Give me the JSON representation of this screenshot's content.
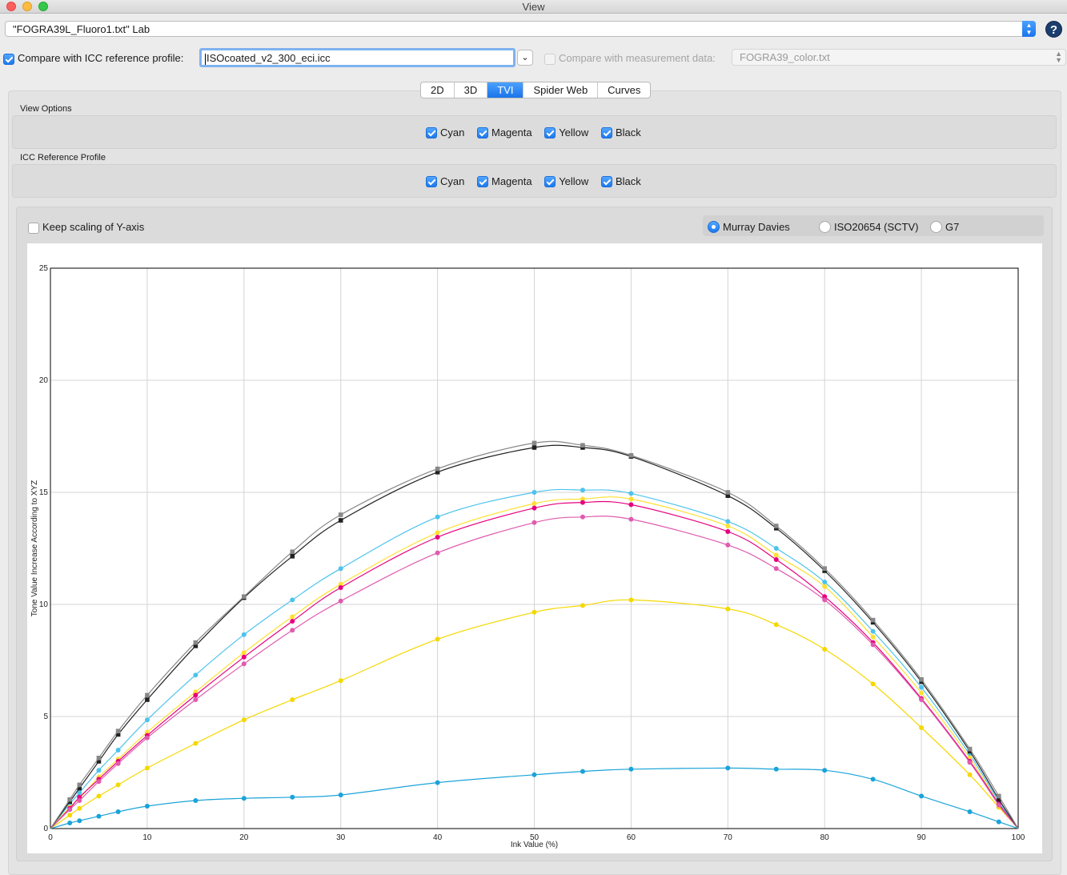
{
  "window": {
    "title": "View"
  },
  "file_select": {
    "value": "\"FOGRA39L_Fluoro1.txt\" Lab"
  },
  "help": {
    "label": "?"
  },
  "compare_icc": {
    "label": "Compare with ICC reference profile:",
    "checked": true,
    "value": "ISOcoated_v2_300_eci.icc"
  },
  "compare_measurement": {
    "label": "Compare with measurement data:",
    "checked": false,
    "value": "FOGRA39_color.txt"
  },
  "tabs": [
    {
      "label": "2D",
      "active": false
    },
    {
      "label": "3D",
      "active": false
    },
    {
      "label": "TVI",
      "active": true
    },
    {
      "label": "Spider Web",
      "active": false
    },
    {
      "label": "Curves",
      "active": false
    }
  ],
  "view_options": {
    "title": "View Options",
    "items": [
      {
        "label": "Cyan",
        "checked": true
      },
      {
        "label": "Magenta",
        "checked": true
      },
      {
        "label": "Yellow",
        "checked": true
      },
      {
        "label": "Black",
        "checked": true
      }
    ]
  },
  "icc_reference": {
    "title": "ICC Reference Profile",
    "items": [
      {
        "label": "Cyan",
        "checked": true
      },
      {
        "label": "Magenta",
        "checked": true
      },
      {
        "label": "Yellow",
        "checked": true
      },
      {
        "label": "Black",
        "checked": true
      }
    ]
  },
  "keep_scaling": {
    "label": "Keep scaling of Y-axis",
    "checked": false
  },
  "tvi_method": {
    "options": [
      {
        "label": "Murray Davies",
        "selected": true
      },
      {
        "label": "ISO20654 (SCTV)",
        "selected": false
      },
      {
        "label": "G7",
        "selected": false
      }
    ]
  },
  "chart_data": {
    "type": "line",
    "xlabel": "Ink Value (%)",
    "ylabel": "Tone Value Increase According to XYZ",
    "xlim": [
      0,
      100
    ],
    "ylim": [
      0,
      25
    ],
    "xticks": [
      0,
      10,
      20,
      30,
      40,
      50,
      60,
      70,
      80,
      90,
      100
    ],
    "yticks": [
      0,
      5,
      10,
      15,
      20,
      25
    ],
    "grid": true,
    "x": [
      0,
      2,
      3,
      5,
      7,
      10,
      15,
      20,
      25,
      30,
      40,
      50,
      55,
      60,
      70,
      75,
      80,
      85,
      90,
      95,
      98,
      100
    ],
    "series": [
      {
        "color": "#1aa3d9",
        "values": [
          0,
          0.25,
          0.35,
          0.55,
          0.75,
          1.0,
          1.25,
          1.35,
          1.4,
          1.5,
          2.05,
          2.4,
          2.55,
          2.65,
          2.7,
          2.65,
          2.6,
          2.2,
          1.45,
          0.75,
          0.3,
          0
        ]
      },
      {
        "color": "#4dc3ec",
        "values": [
          0,
          1.1,
          1.6,
          2.6,
          3.5,
          4.85,
          6.85,
          8.65,
          10.2,
          11.6,
          13.9,
          15.0,
          15.1,
          14.95,
          13.7,
          12.5,
          11.0,
          8.8,
          6.3,
          3.3,
          1.2,
          0
        ]
      },
      {
        "color": "#f5d800",
        "values": [
          0,
          0.6,
          0.9,
          1.45,
          1.95,
          2.7,
          3.8,
          4.85,
          5.75,
          6.6,
          8.45,
          9.65,
          9.95,
          10.2,
          9.8,
          9.1,
          8.0,
          6.45,
          4.5,
          2.4,
          0.95,
          0
        ]
      },
      {
        "color": "#ffe033",
        "values": [
          0,
          0.95,
          1.35,
          2.3,
          3.1,
          4.3,
          6.1,
          7.85,
          9.45,
          10.9,
          13.2,
          14.5,
          14.7,
          14.7,
          13.5,
          12.2,
          10.8,
          8.55,
          6.05,
          3.15,
          1.1,
          0
        ]
      },
      {
        "color": "#e6007e",
        "values": [
          0,
          0.9,
          1.4,
          2.2,
          3.0,
          4.15,
          5.95,
          7.65,
          9.25,
          10.75,
          13.0,
          14.3,
          14.55,
          14.45,
          13.25,
          12.0,
          10.35,
          8.3,
          5.8,
          3.0,
          1.1,
          0
        ]
      },
      {
        "color": "#e05bb0",
        "values": [
          0,
          0.85,
          1.25,
          2.1,
          2.9,
          4.05,
          5.75,
          7.35,
          8.85,
          10.15,
          12.3,
          13.65,
          13.9,
          13.8,
          12.65,
          11.6,
          10.2,
          8.2,
          5.75,
          2.95,
          1.05,
          0
        ]
      },
      {
        "color": "#222222",
        "values": [
          0,
          1.2,
          1.8,
          3.0,
          4.2,
          5.75,
          8.15,
          10.3,
          12.15,
          13.75,
          15.9,
          17.0,
          17.0,
          16.6,
          14.85,
          13.4,
          11.5,
          9.2,
          6.55,
          3.45,
          1.3,
          0
        ]
      },
      {
        "color": "#888888",
        "values": [
          0,
          1.3,
          1.95,
          3.15,
          4.35,
          5.95,
          8.3,
          10.35,
          12.35,
          14.0,
          16.05,
          17.2,
          17.1,
          16.65,
          15.0,
          13.5,
          11.6,
          9.3,
          6.65,
          3.55,
          1.45,
          0
        ]
      }
    ]
  }
}
